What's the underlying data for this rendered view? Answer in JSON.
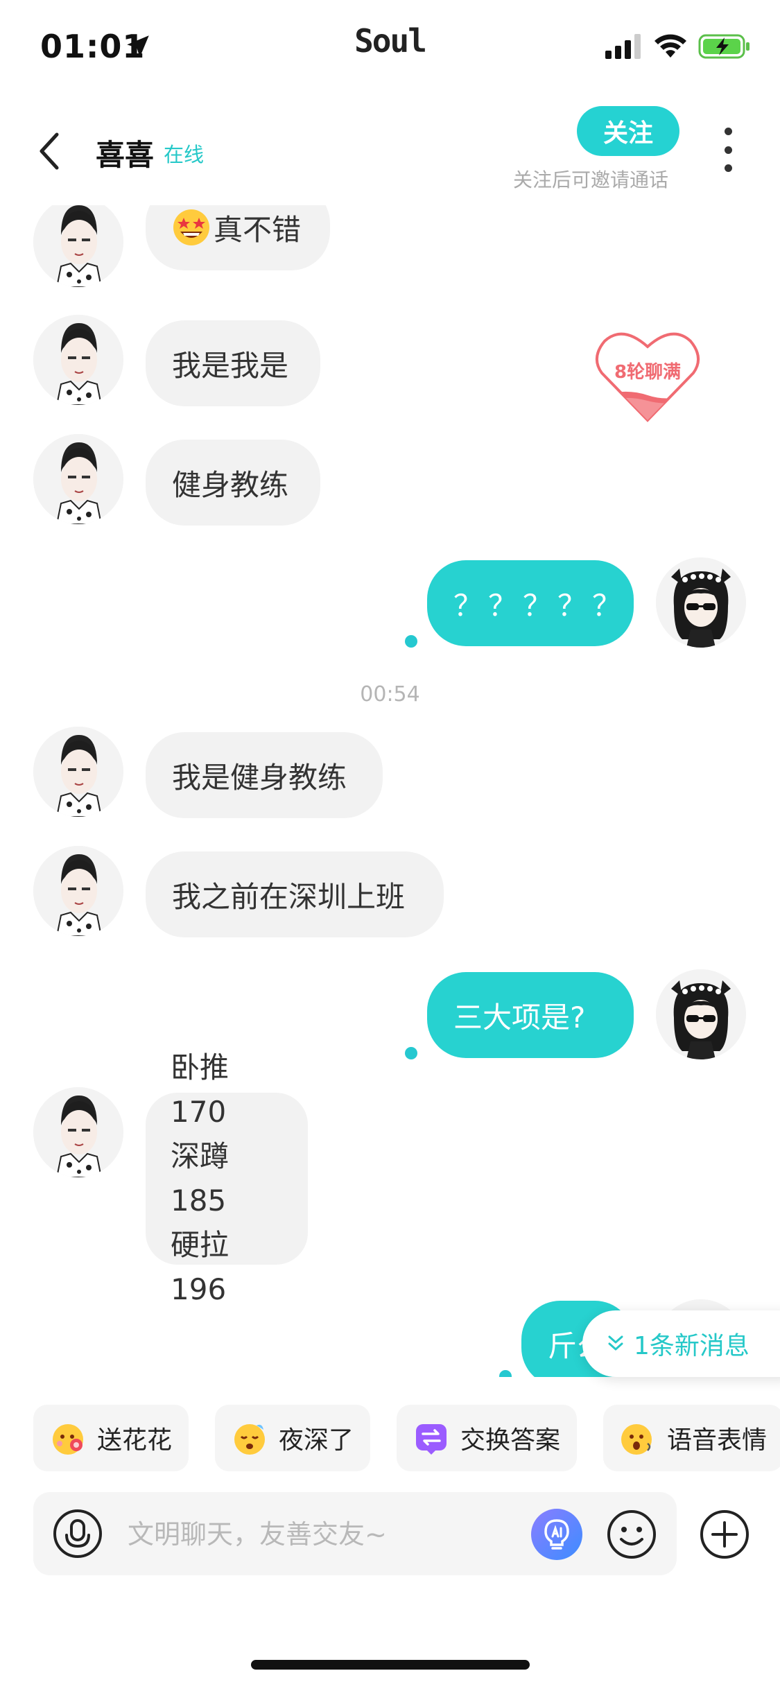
{
  "status_bar": {
    "time": "01:01",
    "app_name": "Soul"
  },
  "header": {
    "title": "喜喜",
    "status": "在线",
    "follow_label": "关注",
    "follow_hint": "关注后可邀请通话"
  },
  "badge": {
    "text": "8轮聊满"
  },
  "messages": [
    {
      "side": "in",
      "text": "真不错",
      "emoji": "star-struck"
    },
    {
      "side": "in",
      "text": "我是我是"
    },
    {
      "side": "in",
      "text": "健身教练"
    },
    {
      "side": "out",
      "text": "？？？？？"
    },
    {
      "side": "in",
      "text": "我是健身教练"
    },
    {
      "side": "in",
      "text": "我之前在深圳上班"
    },
    {
      "side": "out",
      "text": "三大项是?"
    },
    {
      "side": "in",
      "text": "卧推170\n深蹲185\n硬拉196"
    },
    {
      "side": "out",
      "text": "斤么"
    }
  ],
  "timestamp": "00:54",
  "new_message_notice": "1条新消息",
  "quick_actions": [
    {
      "label": "送花花",
      "icon": "flower-emoji-icon"
    },
    {
      "label": "夜深了",
      "icon": "sleepy-emoji-icon"
    },
    {
      "label": "交换答案",
      "icon": "exchange-icon"
    },
    {
      "label": "语音表情",
      "icon": "voice-emoji-icon"
    }
  ],
  "input": {
    "placeholder": "文明聊天，友善交友~"
  },
  "colors": {
    "accent": "#27d2d0",
    "bubble_in": "#f2f2f2",
    "heart": "#f06b72"
  }
}
